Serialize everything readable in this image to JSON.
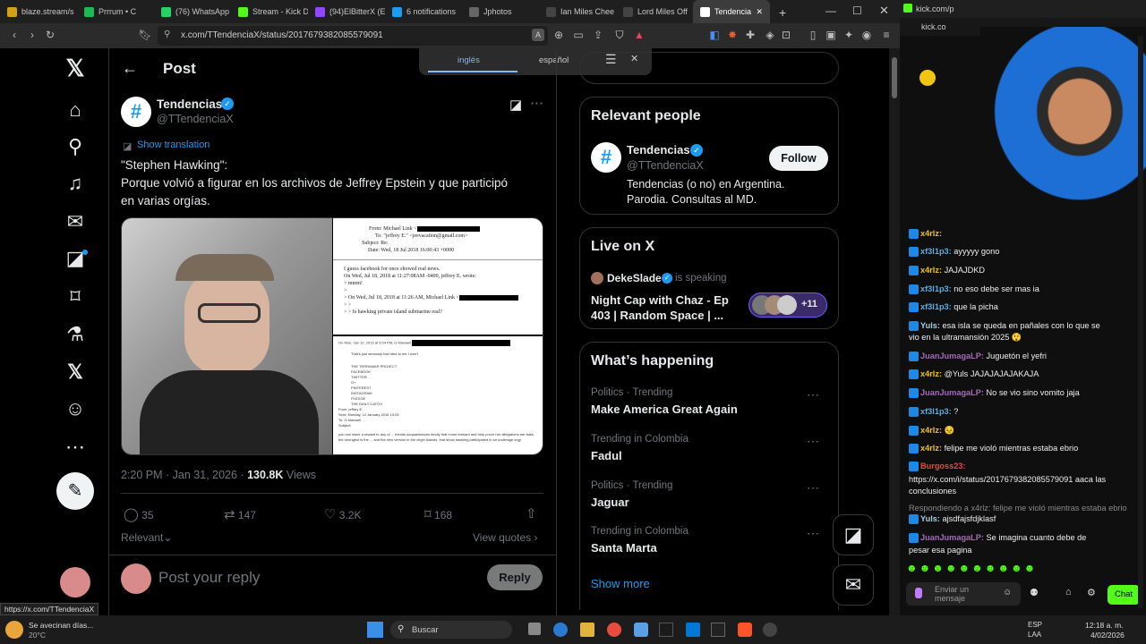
{
  "browser": {
    "tabs": [
      {
        "label": "blaze.stream/s",
        "color": "#d4a017"
      },
      {
        "label": "Prrrum • C",
        "color": "#1db954"
      },
      {
        "label": "(76) WhatsApp",
        "color": "#25d366"
      },
      {
        "label": "Stream - Kick D",
        "color": "#53fc18"
      },
      {
        "label": "(94)ElBitterX (E",
        "color": "#9146ff"
      },
      {
        "label": "6 notifications",
        "color": "#1d9bf0"
      },
      {
        "label": "Jphotos",
        "color": "#666666"
      },
      {
        "label": "Ian Miles Chee",
        "color": "#444444"
      },
      {
        "label": "Lord Miles Off",
        "color": "#444444"
      },
      {
        "label": "Tendencia",
        "color": "#ffffff"
      }
    ],
    "url": "x.com/TTendenciaX/status/2017679382085579091",
    "status_url": "https://x.com/TTendenciaX",
    "translate_popup": {
      "lang1": "inglés",
      "lang2": "español"
    }
  },
  "header": {
    "title": "Post",
    "back_icon": "arrow-left-icon"
  },
  "tweet": {
    "author_name": "Tendencias",
    "author_handle": "@TTendenciaX",
    "avatar_symbol": "#",
    "show_translation": "Show translation",
    "text_line1": "\"Stephen Hawking\":",
    "text_line2": "Porque volvió a figurar en los archivos de Jeffrey Epstein y que participó",
    "text_line3": "en varias orgías.",
    "doc": {
      "from": "From: Michael Link <",
      "to": "To: \"jeffrey E.\" <jeevacation@gmail.com>",
      "subject": "Subject: Re:",
      "date": "Date: Wed, 18 Jul 2018 16:00:43 +0000",
      "body1": "I guess facebook for once showed real news.",
      "body2": "On Wed, Jul 18, 2018 at 11:27:08AM -0400, jeffrey E. wrote:",
      "body3": "> mmm!",
      "body4": "> On Wed, Jul 18, 2018 at 11:26 AM, Michael Link <",
      "body5": "> > Is hawking private island submarine real?",
      "doc2a": "On Mon, Jan 12, 2015 at 3:04 PM, G Maxwell",
      "doc2b": "That's just seriously bad idea to me I won't",
      "doc2c": "THE TERRAMAR PROJECT",
      "doc2d": "FACEBOOK",
      "doc2e": "TWITTER",
      "doc2f": "G+",
      "doc2g": "PINTEREST",
      "doc2h": "INSTAGRAM",
      "doc2i": "PLEDGE",
      "doc2j": "THE DAILY CATCH",
      "doc2k": "From: jeffrey E.",
      "doc2l": "Sent: Monday, 12 January 2015 13:03",
      "doc2m": "To: G Maxwell",
      "doc2n": "Subject:",
      "doc2o": "you can issue a reward to any of ... friends acquaintances family that come forward and help prove her allegations are false. the strongest is the ... and the new version in the virgin islands. that show hawking participated in an underage orgy"
    },
    "time": "2:20 PM · Jan 31, 2026 · ",
    "views_count": "130.8K",
    "views_label": " Views",
    "replies": "35",
    "reposts": "147",
    "likes": "3.2K",
    "bookmarks": "168",
    "relevant": "Relevant",
    "view_quotes": "View quotes",
    "reply_placeholder": "Post your reply",
    "reply_button": "Reply"
  },
  "sidebar": {
    "relevant_title": "Relevant people",
    "person_name": "Tendencias",
    "person_handle": "@TTendenciaX",
    "person_bio1": "Tendencias (o no) en Argentina.",
    "person_bio2": "Parodia. Consultas al MD.",
    "follow": "Follow",
    "live_title": "Live on X",
    "live_host": "DekeSlade",
    "live_status": "is speaking",
    "live_title_text1": "Night Cap with Chaz - Ep",
    "live_title_text2": "403 | Random Space | ...",
    "live_count": "+11",
    "happening_title": "What’s happening",
    "trends": [
      {
        "meta": "Politics · Trending",
        "name": "Make America Great Again"
      },
      {
        "meta": "Trending in Colombia",
        "name": "Fadul"
      },
      {
        "meta": "Politics · Trending",
        "name": "Jaguar"
      },
      {
        "meta": "Trending in Colombia",
        "name": "Santa Marta"
      }
    ],
    "show_more": "Show more"
  },
  "chat": {
    "site": "kick.com/p",
    "site2": "kick.co",
    "messages": [
      {
        "user": "x4rlz:",
        "text": "",
        "color": "#f1c40f"
      },
      {
        "user": "xf3l1p3:",
        "text": "ayyyyy gono",
        "color": "#5dade2"
      },
      {
        "user": "x4rlz:",
        "text": "JAJAJDKD",
        "color": "#f1c40f"
      },
      {
        "user": "xf3l1p3:",
        "text": "no eso debe ser mas ia",
        "color": "#5dade2"
      },
      {
        "user": "xf3l1p3:",
        "text": "que la picha",
        "color": "#5dade2"
      },
      {
        "user": "Yuls:",
        "text": "esa isla se queda en pañales con lo que se",
        "color": "#a9cce3"
      },
      {
        "user": "",
        "text": "vio en la ultramansión 2025 😲",
        "color": "#efefef"
      },
      {
        "user": "JuanJumagaLP:",
        "text": "Juguetón el yefri",
        "color": "#a569bd"
      },
      {
        "user": "x4rlz:",
        "text": "@Yuls JAJAJAJAJAKAJA",
        "color": "#f1c40f"
      },
      {
        "user": "JuanJumagaLP:",
        "text": "No se vio sino vomito jaja",
        "color": "#a569bd"
      },
      {
        "user": "xf3l1p3:",
        "text": "?",
        "color": "#5dade2"
      },
      {
        "user": "x4rlz:",
        "text": "😣",
        "color": "#f1c40f"
      },
      {
        "user": "x4rlz:",
        "text": "felipe me violó mientras estaba ebrio",
        "color": "#f1c40f"
      },
      {
        "user": "Burgoss23:",
        "text": "",
        "color": "#e74c3c"
      },
      {
        "user": "",
        "text": "https://x.com/i/status/2017679382085579091 aaca las",
        "color": "#efefef"
      },
      {
        "user": "",
        "text": "conclusiones",
        "color": "#efefef"
      },
      {
        "user": "",
        "text": "Respondiendo a x4rlz: felipe me violó mientras estaba ebrio",
        "color": "#8a8a8a"
      },
      {
        "user": "Yuls:",
        "text": "ajsdfajsfdjklasf",
        "color": "#a9cce3"
      },
      {
        "user": "JuanJumagaLP:",
        "text": "Se imagina cuanto debe de",
        "color": "#a569bd"
      },
      {
        "user": "",
        "text": "pesar esa pagina",
        "color": "#efefef"
      }
    ],
    "input_placeholder": "Enviar un mensaje",
    "chat_button": "Chat"
  },
  "taskbar": {
    "weather1": "Se avecinan días...",
    "weather2": "20°C",
    "search": "Buscar",
    "lang1": "ESP",
    "lang2": "LAA",
    "time": "12:18 a. m.",
    "date": "4/02/2026"
  }
}
